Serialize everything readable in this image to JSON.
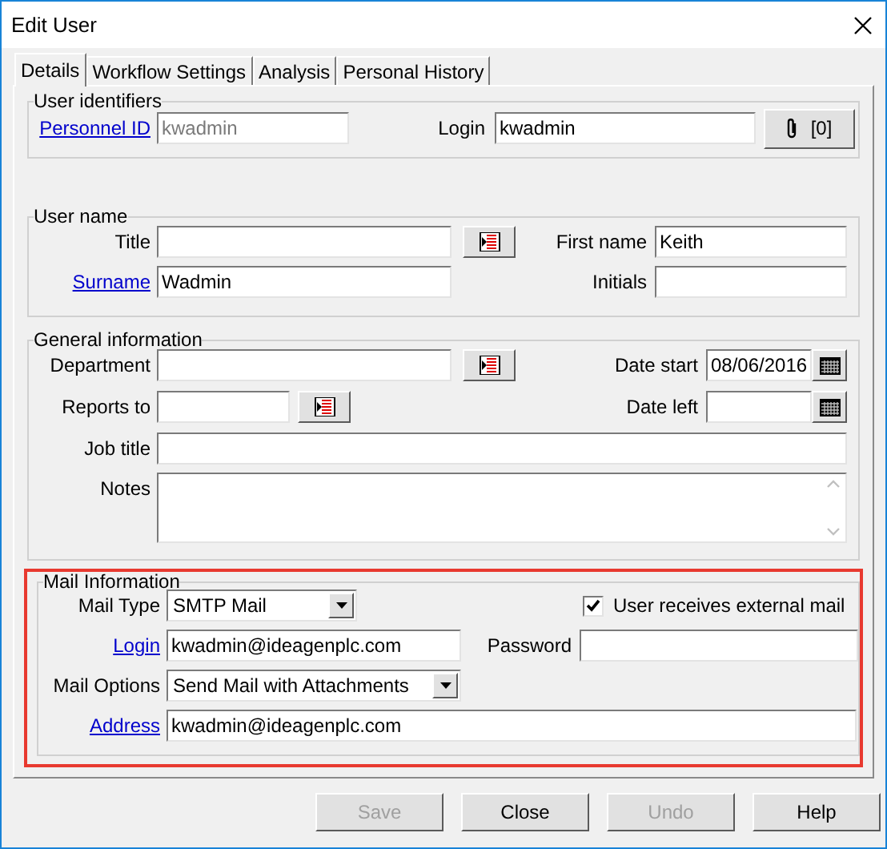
{
  "window": {
    "title": "Edit User"
  },
  "tabs": [
    {
      "label": "Details",
      "selected": true
    },
    {
      "label": "Workflow Settings",
      "selected": false
    },
    {
      "label": "Analysis",
      "selected": false
    },
    {
      "label": "Personal History",
      "selected": false
    }
  ],
  "user_identifiers": {
    "title": "User identifiers",
    "personnel_id": {
      "label": "Personnel ID",
      "link": true,
      "value": "kwadmin",
      "disabled": true
    },
    "login": {
      "label": "Login",
      "link": false,
      "value": "kwadmin",
      "disabled": false
    },
    "attachments_button": {
      "label": "[0]"
    }
  },
  "user_name": {
    "title": "User name",
    "title_field": {
      "label": "Title",
      "link": false
    },
    "first_name": {
      "label": "First name",
      "link": false,
      "value": "Keith"
    },
    "surname": {
      "label": "Surname",
      "link": true,
      "value": "Wadmin"
    },
    "initials": {
      "label": "Initials",
      "link": false
    }
  },
  "general_information": {
    "title": "General information",
    "department": {
      "label": "Department",
      "link": false
    },
    "date_start": {
      "label": "Date start",
      "link": false,
      "value": "08/06/2016"
    },
    "reports_to": {
      "label": "Reports to",
      "link": false
    },
    "date_left": {
      "label": "Date left",
      "link": false
    },
    "job_title": {
      "label": "Job title",
      "link": false
    },
    "notes": {
      "label": "Notes",
      "link": false
    }
  },
  "mail_information": {
    "title": "Mail Information",
    "highlighted": true,
    "mail_type": {
      "label": "Mail Type",
      "link": false,
      "value": "SMTP Mail"
    },
    "external_mail": {
      "label": "User receives external mail",
      "checked": true
    },
    "login": {
      "label": "Login",
      "link": true,
      "value": "kwadmin@ideagenplc.com"
    },
    "password": {
      "label": "Password",
      "link": false
    },
    "mail_options": {
      "label": "Mail Options",
      "link": false,
      "value": "Send Mail with Attachments"
    },
    "address": {
      "label": "Address",
      "link": true,
      "value": "kwadmin@ideagenplc.com"
    }
  },
  "buttons": [
    {
      "label": "Save",
      "disabled": true
    },
    {
      "label": "Close",
      "disabled": false
    },
    {
      "label": "Undo",
      "disabled": true
    },
    {
      "label": "Help",
      "disabled": false
    }
  ]
}
